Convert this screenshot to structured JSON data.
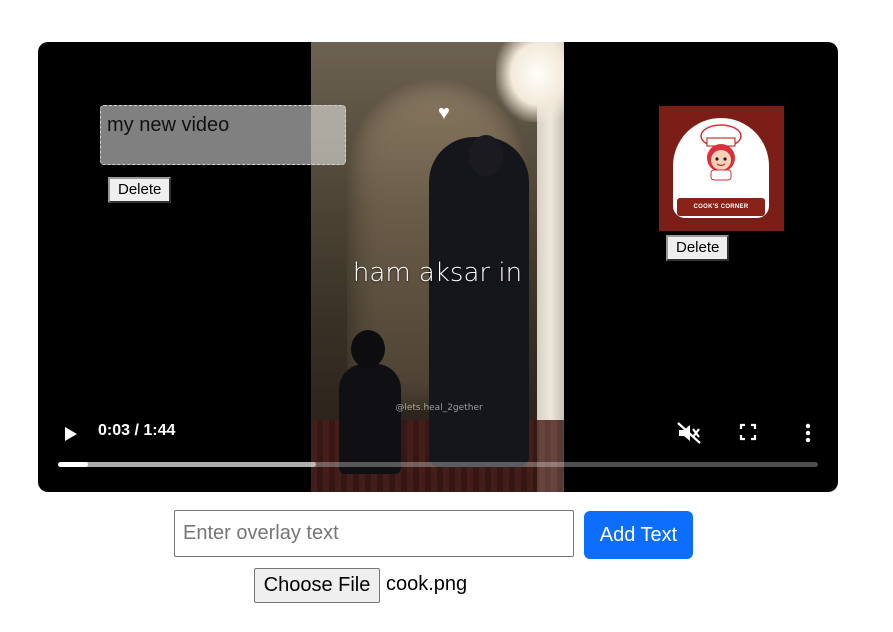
{
  "video": {
    "caption": "ham aksar in",
    "watermark": "@lets.heal_2gether",
    "text_overlay": "my new video",
    "delete_label": "Delete",
    "logo_band_text": "COOK'S CORNER",
    "time_display": "0:03 / 1:44",
    "progress_fraction": 0.04,
    "buffered_fraction": 0.34
  },
  "controls": {
    "play_icon": "play-icon",
    "mute_icon": "volume-muted-icon",
    "fullscreen_icon": "fullscreen-icon",
    "more_icon": "more-vertical-icon"
  },
  "form": {
    "overlay_placeholder": "Enter overlay text",
    "overlay_value": "",
    "add_button": "Add Text",
    "choose_file_button": "Choose File",
    "file_name": "cook.png"
  },
  "colors": {
    "accent": "#0d6efd",
    "logo_bg": "#7b1e17"
  }
}
